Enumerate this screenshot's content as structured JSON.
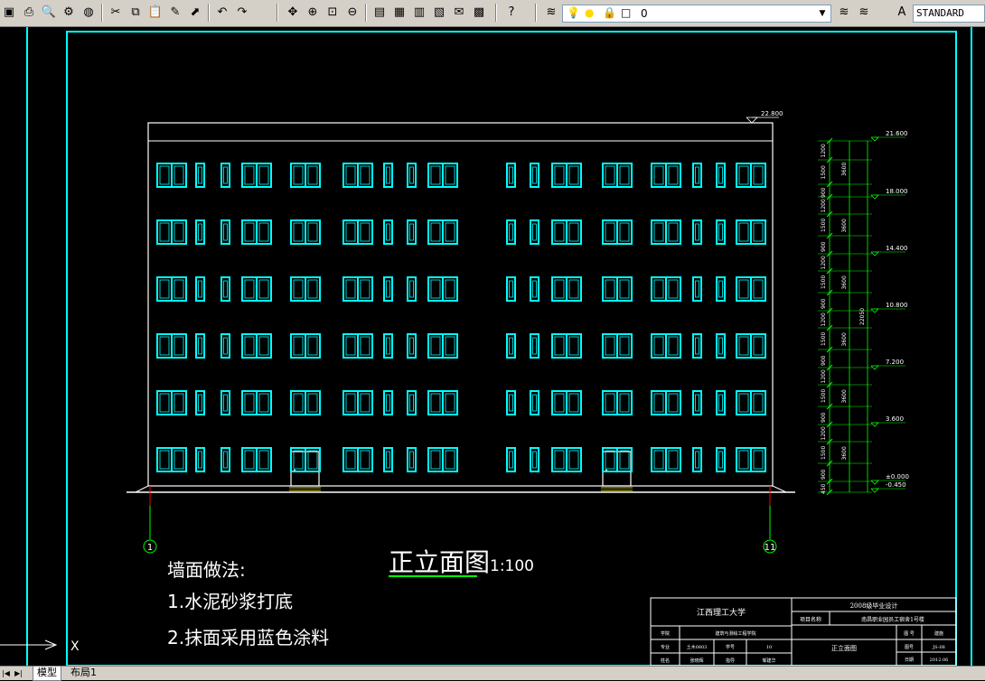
{
  "toolbar": {
    "buttons": [
      {
        "name": "save-icon",
        "glyph": "▣"
      },
      {
        "name": "plot-icon",
        "glyph": "⎙"
      },
      {
        "name": "plot-preview-icon",
        "glyph": "🔍"
      },
      {
        "name": "publish-icon",
        "glyph": "⚙"
      },
      {
        "name": "globe-icon",
        "glyph": "◍"
      },
      {
        "name": "cut-icon",
        "glyph": "✂"
      },
      {
        "name": "copy-icon",
        "glyph": "⧉"
      },
      {
        "name": "paste-icon",
        "glyph": "📋"
      },
      {
        "name": "match-properties-icon",
        "glyph": "✎"
      },
      {
        "name": "block-editor-icon",
        "glyph": "⬈"
      },
      {
        "name": "undo-icon",
        "glyph": "↶"
      },
      {
        "name": "redo-icon",
        "glyph": "↷"
      },
      {
        "name": "pan-icon",
        "glyph": "✥"
      },
      {
        "name": "zoom-realtime-icon",
        "glyph": "⊕"
      },
      {
        "name": "zoom-window-icon",
        "glyph": "⊡"
      },
      {
        "name": "zoom-previous-icon",
        "glyph": "⊖"
      },
      {
        "name": "properties-icon",
        "glyph": "▤"
      },
      {
        "name": "design-center-icon",
        "glyph": "▦"
      },
      {
        "name": "tool-palettes-icon",
        "glyph": "▥"
      },
      {
        "name": "sheet-set-icon",
        "glyph": "▧"
      },
      {
        "name": "markup-icon",
        "glyph": "✉"
      },
      {
        "name": "calculator-icon",
        "glyph": "▩"
      },
      {
        "name": "help-icon",
        "glyph": "?"
      }
    ],
    "layer_manager_icon": "layers-icon",
    "layer_name": "0",
    "layer_state_icons": [
      "bulb-icon",
      "sun-icon",
      "lock-icon",
      "color-square-icon"
    ],
    "text_style_icon": "text-style-icon",
    "text_style": "STANDARD"
  },
  "drawing": {
    "colors": {
      "background": "#000000",
      "frame": "#00ffff",
      "building": "#ffffff",
      "window": "#00ffff",
      "axis": "#ff0000",
      "grid": "#00ff00",
      "dim": "#00ff00",
      "level": "#ffff00",
      "text": "#ffffff",
      "title_underline": "#00ff00"
    },
    "top_level": "22.800",
    "levels": [
      "21.600",
      "18.000",
      "14.400",
      "10.800",
      "7.200",
      "3.600",
      "±0.000",
      "-0.450"
    ],
    "dim_segments": [
      "1200",
      "1500",
      "900",
      "1200",
      "1500",
      "900",
      "1200",
      "1500",
      "900",
      "1200",
      "1500",
      "900",
      "1200",
      "1500",
      "900",
      "1200",
      "1500",
      "900",
      "450"
    ],
    "dim_floor_totals": [
      "3600",
      "3600",
      "3600",
      "3600",
      "3600",
      "3600"
    ],
    "dim_total": "22050",
    "grid_left": "1",
    "grid_right": "11",
    "drawing_title": "正立面图",
    "scale": "1:100",
    "notes_title": "墙面做法:",
    "notes": [
      "1.水泥砂浆打底",
      "2.抹面采用蓝色涂料"
    ],
    "title_block": {
      "university": "江西理工大学",
      "design": "2008级毕业设计",
      "project_label": "项目名称",
      "project_name": "南昌职业园员工宿舍1号楼",
      "sheet_name": "正立面图",
      "row_labels": [
        "学院",
        "专业",
        "姓名"
      ],
      "row_values": [
        "建筑与测绘工程学院",
        "土木0803",
        "张晓辉"
      ],
      "sub_labels": [
        "学号",
        "指导"
      ],
      "sub_values": [
        "10",
        "邹建华"
      ],
      "right_labels": [
        "图号",
        "日期"
      ],
      "right_head": [
        "图 号",
        "建施"
      ],
      "right_values": [
        "JS-08",
        "2012.06"
      ]
    },
    "ucs_x_label": "X"
  },
  "tabs": {
    "nav": [
      "|◀",
      "▶|"
    ],
    "model": "模型",
    "layout1": "布局1"
  }
}
